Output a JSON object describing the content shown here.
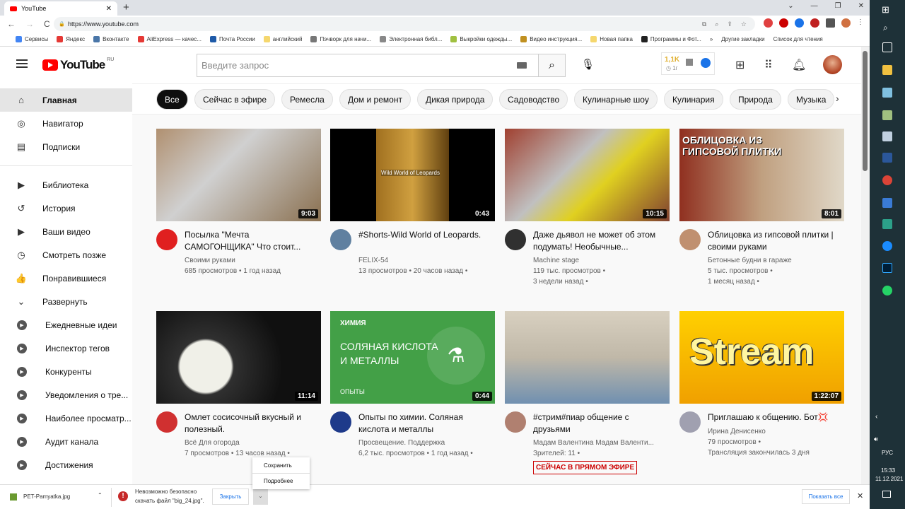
{
  "browser": {
    "tab_title": "YouTube",
    "url": "https://www.youtube.com",
    "bookmarks": [
      {
        "label": "Сервисы",
        "color": "#4285f4"
      },
      {
        "label": "Яндекс",
        "color": "#e53935"
      },
      {
        "label": "Вконтакте",
        "color": "#4a76a8"
      },
      {
        "label": "AliExpress — качес...",
        "color": "#e53935"
      },
      {
        "label": "Почта России",
        "color": "#1e5aa8"
      },
      {
        "label": "английский",
        "color": "#f5d76e"
      },
      {
        "label": "Пэчворк для начи...",
        "color": "#777"
      },
      {
        "label": "Электронная библ...",
        "color": "#888"
      },
      {
        "label": "Выкройки одежды...",
        "color": "#a0c040"
      },
      {
        "label": "Видео инструкция...",
        "color": "#c09020"
      },
      {
        "label": "Новая папка",
        "color": "#f5d76e"
      },
      {
        "label": "Программы и Фот...",
        "color": "#222"
      }
    ],
    "bookmarks_more": "»",
    "other_bookmarks": "Другие закладки",
    "reading_list": "Список для чтения"
  },
  "youtube": {
    "logo_text": "YouTube",
    "logo_region": "RU",
    "search_placeholder": "Введите запрос",
    "stats": {
      "count": "1,1K",
      "time": "1г"
    },
    "sidebar": [
      {
        "label": "Главная",
        "icon": "home-icon",
        "glyph": "⌂",
        "active": true
      },
      {
        "label": "Навигатор",
        "icon": "compass-icon",
        "glyph": "◎"
      },
      {
        "label": "Подписки",
        "icon": "subscriptions-icon",
        "glyph": "▤"
      },
      {
        "sep": true
      },
      {
        "label": "Библиотека",
        "icon": "library-icon",
        "glyph": "▶"
      },
      {
        "label": "История",
        "icon": "history-icon",
        "glyph": "↺"
      },
      {
        "label": "Ваши видео",
        "icon": "your-videos-icon",
        "glyph": "▶"
      },
      {
        "label": "Смотреть позже",
        "icon": "watch-later-icon",
        "glyph": "◷"
      },
      {
        "label": "Понравившиеся",
        "icon": "like-icon",
        "glyph": "👍"
      },
      {
        "label": "Развернуть",
        "icon": "chevron-down-icon",
        "glyph": "⌄"
      },
      {
        "label": "Ежедневные идеи",
        "icon": "channel-icon",
        "sub": true
      },
      {
        "label": "Инспектор тегов",
        "icon": "channel-icon",
        "sub": true
      },
      {
        "label": "Конкуренты",
        "icon": "channel-icon",
        "sub": true
      },
      {
        "label": "Уведомления о тре...",
        "icon": "channel-icon",
        "sub": true
      },
      {
        "label": "Наиболее просматр...",
        "icon": "channel-icon",
        "sub": true
      },
      {
        "label": "Аудит канала",
        "icon": "channel-icon",
        "sub": true
      },
      {
        "label": "Достижения",
        "icon": "channel-icon",
        "sub": true
      }
    ],
    "chips": [
      "Все",
      "Сейчас в эфире",
      "Ремесла",
      "Дом и ремонт",
      "Дикая природа",
      "Садоводство",
      "Кулинарные шоу",
      "Кулинария",
      "Природа",
      "Музыка"
    ],
    "videos": [
      {
        "title": "Посылка \"Мечта САМОГОНЩИКА\" Что стоит...",
        "channel": "Своими руками",
        "meta": [
          "685 просмотров • 1 год назад"
        ],
        "duration": "9:03",
        "thumb": "linear-gradient(135deg,#b09070,#d0d0d0 40%,#8a7050)",
        "avatar": "#e02020"
      },
      {
        "title": "#Shorts-Wild World of Leopards.",
        "channel": "FELIX-54",
        "meta": [
          "13 просмотров • 20 часов назад •"
        ],
        "duration": "0:43",
        "thumb": "linear-gradient(90deg,#000 28%,#a07020 28%,#d0a040 50%,#604010 72%,#000 72%)",
        "avatar": "#6080a0",
        "thumb_text": "Wild World of Leopards"
      },
      {
        "title": "Даже дьявол не может об этом подумать! Необычные...",
        "channel": "Machine stage",
        "meta": [
          "119 тыс. просмотров •",
          "3 недели назад •"
        ],
        "duration": "10:15",
        "thumb": "linear-gradient(135deg,#a04030,#c0c0c0 40%,#e0d020 60%,#804030)",
        "avatar": "#303030"
      },
      {
        "title": "Облицовка из гипсовой плитки | своими руками",
        "channel": "Бетонные будни в гараже",
        "meta": [
          "5 тыс. просмотров •",
          "1 месяц назад •"
        ],
        "duration": "8:01",
        "thumb": "linear-gradient(90deg,#903020,#c0a080 50%,#e0d8c8)",
        "avatar": "#c09070",
        "thumb_text": "ОБЛИЦОВКА ИЗ ГИПСОВОЙ ПЛИТКИ"
      },
      {
        "title": "Омлет сосисочный вкусный и полезный.",
        "channel": "Всё Для огорода",
        "meta": [
          "7 просмотров • 13 часов назад •"
        ],
        "duration": "11:14",
        "thumb": "radial-gradient(circle at 30% 60%,#f0f0e8 20%,#303030 22%,#101010 60%)",
        "avatar": "#d03030"
      },
      {
        "title": "Опыты по химии. Соляная кислота и металлы",
        "channel": "Просвещение. Поддержка",
        "meta": [
          "6,2 тыс. просмотров • 1 год назад •"
        ],
        "duration": "0:44",
        "thumb": "#43a047",
        "avatar": "#1e3a8a",
        "thumb_label": "ХИМИЯ",
        "thumb_text": "СОЛЯНАЯ КИСЛОТА И МЕТАЛЛЫ",
        "thumb_foot": "ОПЫТЫ"
      },
      {
        "title": "#стрим#пиар общение с друзьями",
        "channel": "Мадам Валентина Мадам Валенти...",
        "meta": [
          "Зрителей: 11 •"
        ],
        "live_badge": "СЕЙЧАС В ПРЯМОМ ЭФИРЕ",
        "thumb": "linear-gradient(180deg,#d8d0c0,#c0b8a8 50%,#7090b0)",
        "avatar": "#b08070"
      },
      {
        "title": "Приглашаю к общению. Бот💢",
        "channel": "Ирина Денисенко",
        "meta": [
          "79 просмотров •",
          "Трансляция закончилась 3 дня"
        ],
        "duration": "1:22:07",
        "thumb": "linear-gradient(180deg,#ffd000,#f0a000)",
        "avatar": "#a0a0b0",
        "thumb_text": "Stream"
      }
    ]
  },
  "context_menu": {
    "items": [
      "Сохранить",
      "Подробнее"
    ]
  },
  "downloads": {
    "file": "PET-Pamyatka.jpg",
    "error_line1": "Невозможно безопасно",
    "error_line2": "скачать файл \"big_24.jpg\".",
    "close": "Закрыть",
    "show_all": "Показать все"
  },
  "taskbar": {
    "lang": "РУС",
    "time": "15:33",
    "date": "11.12.2021"
  }
}
